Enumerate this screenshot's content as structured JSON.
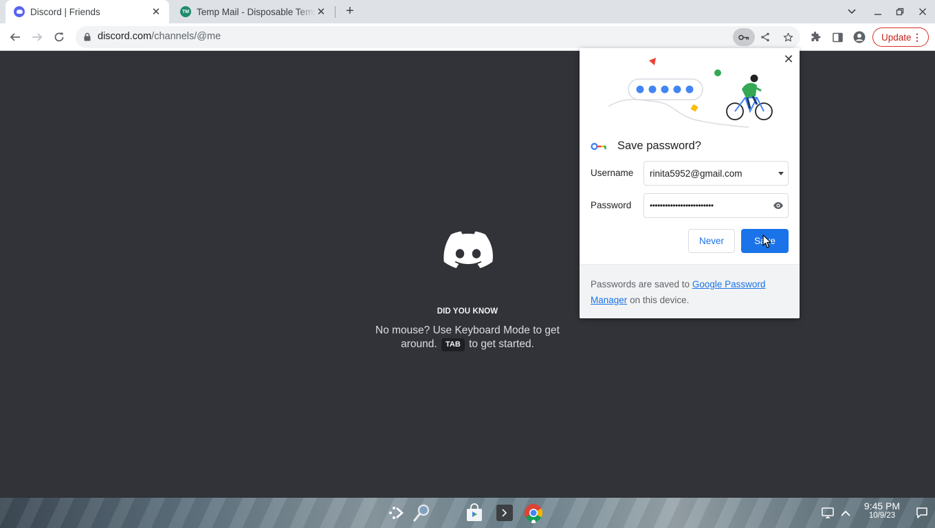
{
  "tabs": [
    {
      "title": "Discord | Friends",
      "favicon": "discord-icon",
      "active": true
    },
    {
      "title": "Temp Mail - Disposable Temporary Email",
      "favicon": "tempmail-icon",
      "favicon_text": "TM",
      "active": false
    }
  ],
  "toolbar": {
    "url_host": "discord.com",
    "url_path": "/channels/@me",
    "update_label": "Update"
  },
  "page": {
    "did_you_know": "DID YOU KNOW",
    "tip_before": "No mouse? Use Keyboard Mode to get around.",
    "tip_key": "TAB",
    "tip_after": "to get started."
  },
  "save_password": {
    "title": "Save password?",
    "username_label": "Username",
    "username_value": "rinita5952@gmail.com",
    "password_label": "Password",
    "password_value": "•••••••••••••••••••••••••",
    "never_label": "Never",
    "save_label": "Save",
    "footer_before": "Passwords are saved to",
    "footer_link": "Google Password Manager",
    "footer_after": "on this device."
  },
  "shelf": {
    "time": "9:45 PM",
    "date": "10/9/23"
  },
  "colors": {
    "discord_bg": "#313338",
    "chrome_blue": "#1a73e8",
    "update_red": "#d93025"
  }
}
